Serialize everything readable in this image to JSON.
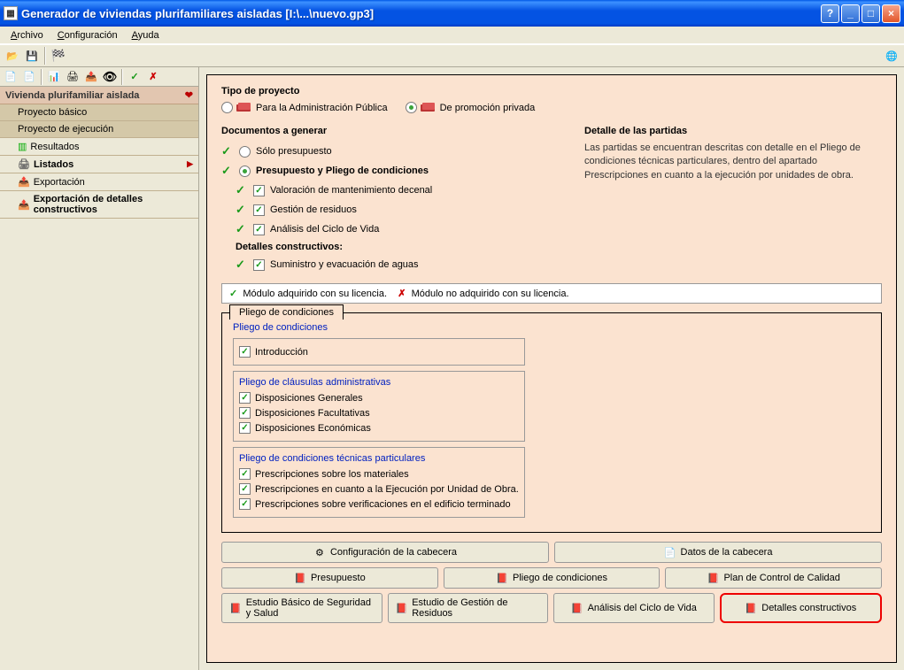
{
  "titlebar": {
    "title": "Generador de viviendas plurifamiliares aisladas  [I:\\...\\nuevo.gp3]"
  },
  "menubar": {
    "items": [
      "Archivo",
      "Configuración",
      "Ayuda"
    ]
  },
  "tree": {
    "header": "Vivienda plurifamiliar aislada",
    "items": [
      {
        "label": "Proyecto básico",
        "icon": "",
        "bold": false
      },
      {
        "label": "Proyecto de ejecución",
        "icon": "",
        "bold": false
      },
      {
        "label": "Resultados",
        "icon": "chart",
        "bold": false,
        "sub": true
      },
      {
        "label": "Listados",
        "icon": "printer",
        "bold": true,
        "sub": true,
        "arrow": true
      },
      {
        "label": "Exportación",
        "icon": "export",
        "bold": false,
        "sub": true
      },
      {
        "label": "Exportación de detalles constructivos",
        "icon": "export",
        "bold": true,
        "sub": true
      }
    ]
  },
  "main": {
    "tipo_proyecto_title": "Tipo de proyecto",
    "radio1": "Para la Administración Pública",
    "radio2": "De promoción privada",
    "docs_title": "Documentos a generar",
    "docs": [
      {
        "label": "Sólo presupuesto",
        "type": "radio",
        "checked": false,
        "bold": false
      },
      {
        "label": "Presupuesto y Pliego de condiciones",
        "type": "radio",
        "checked": true,
        "bold": true
      },
      {
        "label": "Valoración de mantenimiento decenal",
        "type": "check",
        "checked": true,
        "indent": true
      },
      {
        "label": "Gestión de residuos",
        "type": "check",
        "checked": true,
        "indent": true
      },
      {
        "label": "Análisis del Ciclo de Vida",
        "type": "check",
        "checked": true,
        "indent": true
      }
    ],
    "detalles_header": "Detalles constructivos:",
    "detalle_item": "Suministro y evacuación de aguas",
    "detalle_title": "Detalle de las partidas",
    "detalle_text": "Las partidas se encuentran descritas con detalle en el Pliego de condiciones técnicas particulares, dentro del apartado Prescripciones en cuanto a la ejecución por unidades de obra.",
    "legend_ok": "Módulo adquirido con su licencia.",
    "legend_no": "Módulo no adquirido con su licencia.",
    "pliego_tab": "Pliego de condiciones",
    "pliego_title": "Pliego de condiciones",
    "pliego_intro": "Introducción",
    "pliego_g1_title": "Pliego de cláusulas administrativas",
    "pliego_g1": [
      "Disposiciones Generales",
      "Disposiciones Facultativas",
      "Disposiciones Económicas"
    ],
    "pliego_g2_title": "Pliego de condiciones técnicas particulares",
    "pliego_g2": [
      "Prescripciones sobre los materiales",
      "Prescripciones en cuanto a la Ejecución por Unidad de Obra.",
      "Prescripciones sobre verificaciones en el edificio terminado"
    ],
    "buttons": {
      "config_cabecera": "Configuración de la cabecera",
      "datos_cabecera": "Datos de la cabecera",
      "presupuesto": "Presupuesto",
      "pliego": "Pliego de condiciones",
      "plan_calidad": "Plan de Control de Calidad",
      "estudio_seguridad": "Estudio Básico de Seguridad y Salud",
      "estudio_residuos": "Estudio de Gestión de Residuos",
      "analisis_ciclo": "Análisis del Ciclo de Vida",
      "detalles_constructivos": "Detalles constructivos"
    }
  }
}
